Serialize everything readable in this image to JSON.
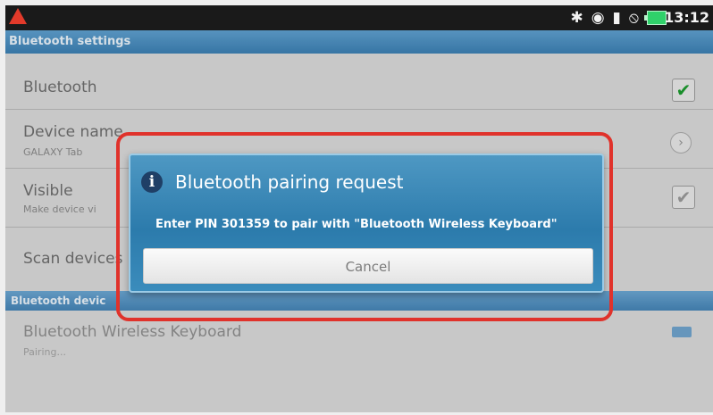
{
  "status_bar": {
    "time": "13:12",
    "icons": [
      "warning-icon",
      "bluetooth-icon",
      "wifi-icon",
      "sdcard-icon",
      "alarm-off-icon",
      "battery-icon"
    ]
  },
  "title_bar": {
    "title": "Bluetooth settings"
  },
  "settings": {
    "bluetooth": {
      "label": "Bluetooth",
      "checked": true
    },
    "device_name": {
      "label": "Device name",
      "value": "GALAXY Tab"
    },
    "visible": {
      "label": "Visible",
      "sublabel": "Make device vi",
      "checked": true
    },
    "scan": {
      "label": "Scan devices"
    },
    "section_header": "Bluetooth devic",
    "paired_device": {
      "name": "Bluetooth Wireless Keyboard",
      "status": "Pairing..."
    }
  },
  "dialog": {
    "title": "Bluetooth pairing request",
    "message": "Enter PIN 301359 to pair with \"Bluetooth Wireless Keyboard\"",
    "cancel_label": "Cancel"
  },
  "colors": {
    "dialog_blue": "#2c7bac",
    "highlight_red": "#e0322b",
    "check_green": "#1d9b2f"
  }
}
